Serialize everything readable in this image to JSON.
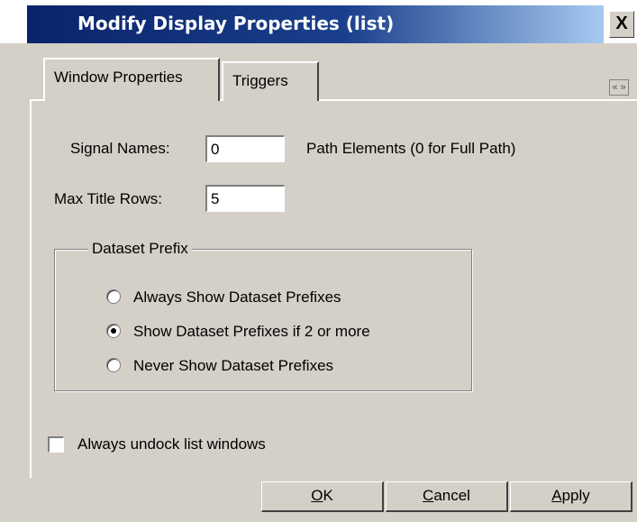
{
  "dialog": {
    "title": "Modify Display Properties (list)",
    "close_label": "X"
  },
  "tabs": [
    {
      "label": "Window Properties",
      "active": true
    },
    {
      "label": "Triggers",
      "active": false
    }
  ],
  "tab_scroll": "« »",
  "window_properties": {
    "signal_names_label": "Signal Names:",
    "signal_names_value": "0",
    "signal_names_suffix": "Path Elements (0 for Full Path)",
    "max_title_rows_label": "Max Title Rows:",
    "max_title_rows_value": "5"
  },
  "dataset_prefix": {
    "legend": "Dataset Prefix",
    "options": [
      {
        "label": "Always Show Dataset Prefixes",
        "checked": false
      },
      {
        "label": "Show Dataset Prefixes if 2 or more",
        "checked": true
      },
      {
        "label": "Never Show Dataset Prefixes",
        "checked": false
      }
    ]
  },
  "undock": {
    "label": "Always undock list windows",
    "checked": false
  },
  "buttons": {
    "ok": {
      "label": "OK",
      "access_key": "O"
    },
    "cancel": {
      "label": "Cancel",
      "access_key": "C"
    },
    "apply": {
      "label": "Apply",
      "access_key": "A"
    }
  }
}
